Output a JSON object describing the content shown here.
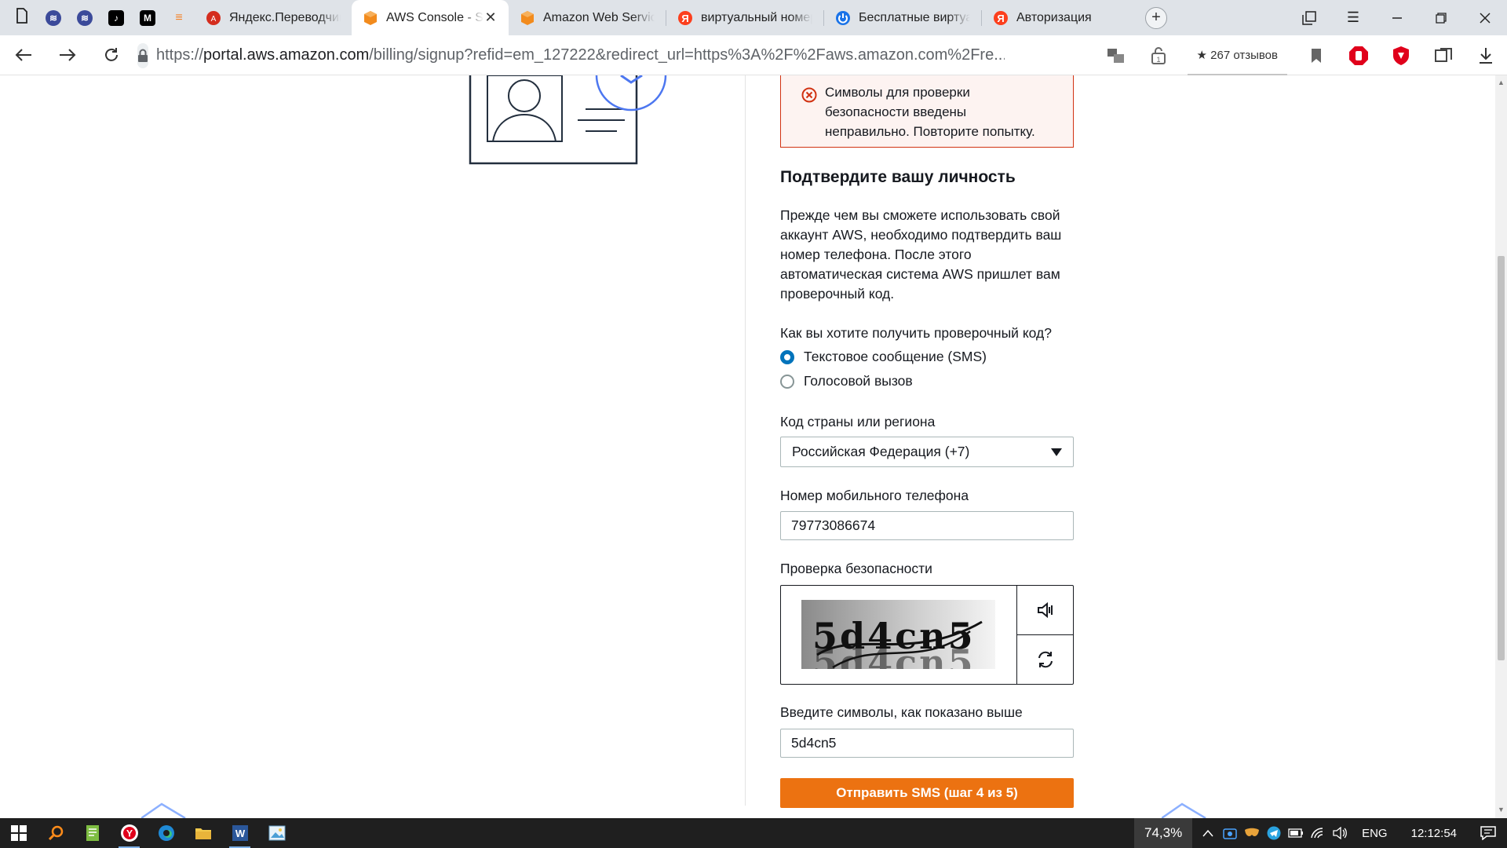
{
  "browser": {
    "tabs": [
      {
        "title": "Яндекс.Переводчик",
        "favicon": "yandex-translate-icon",
        "active": false
      },
      {
        "title": "AWS Console - Sig",
        "favicon": "aws-cube-icon",
        "active": true
      },
      {
        "title": "Amazon Web Service",
        "favicon": "aws-cube-icon",
        "active": false
      },
      {
        "title": "виртуальный номер",
        "favicon": "yandex-icon",
        "active": false
      },
      {
        "title": "Бесплатные виртуал",
        "favicon": "power-icon",
        "active": false
      },
      {
        "title": "Авторизация",
        "favicon": "yandex-icon",
        "active": false
      }
    ],
    "url_prefix": "https://",
    "url_host": "portal.aws.amazon.com",
    "url_path": "/billing/signup?refid=em_127222&redirect_url=https%3A%2F%2Faws.amazon.com%2Fre...",
    "reviews": "★ 267 отзывов"
  },
  "form": {
    "error": "Символы для проверки безопасности введены неправильно. Повторите попытку.",
    "heading": "Подтвердите вашу личность",
    "description": "Прежде чем вы сможете использовать свой аккаунт AWS, необходимо подтвердить ваш номер телефона. После этого автоматическая система AWS пришлет вам проверочный код.",
    "method_question": "Как вы хотите получить проверочный код?",
    "method_options": [
      {
        "label": "Текстовое сообщение (SMS)",
        "selected": true
      },
      {
        "label": "Голосовой вызов",
        "selected": false
      }
    ],
    "country_label": "Код страны или региона",
    "country_value": "Российская Федерация (+7)",
    "phone_label": "Номер мобильного телефона",
    "phone_value": "79773086674",
    "security_label": "Проверка безопасности",
    "captcha_text": "5d4cn5",
    "captcha_input_label": "Введите символы, как показано выше",
    "captcha_input_value": "5d4cn5",
    "submit_label": "Отправить SMS (шаг 4 из 5)",
    "accent_color": "#ec7211",
    "error_color": "#d13212"
  },
  "taskbar": {
    "zoom": "74,3%",
    "language": "ENG",
    "time": "12:12:54"
  }
}
